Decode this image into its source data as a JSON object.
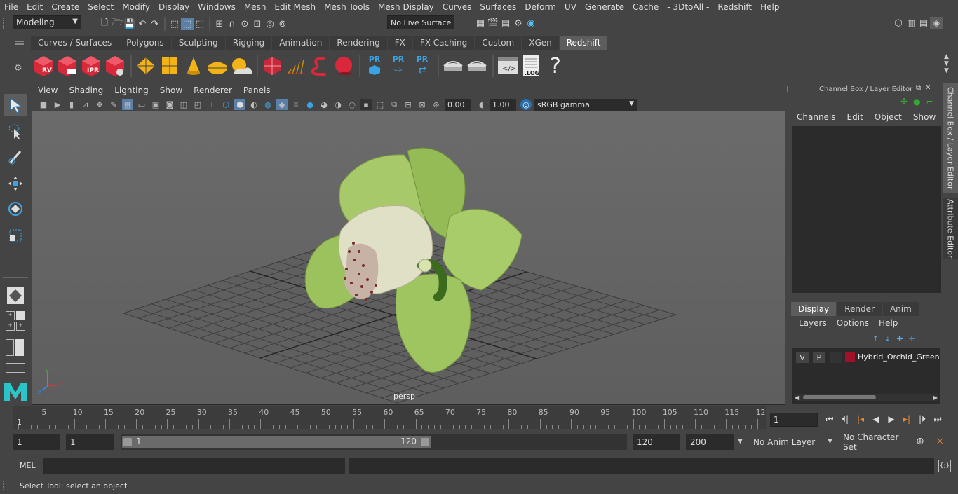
{
  "menu": [
    "File",
    "Edit",
    "Create",
    "Select",
    "Modify",
    "Display",
    "Windows",
    "Mesh",
    "Edit Mesh",
    "Mesh Tools",
    "Mesh Display",
    "Curves",
    "Surfaces",
    "Deform",
    "UV",
    "Generate",
    "Cache",
    "- 3DtoAll -",
    "Redshift",
    "Help"
  ],
  "status": {
    "mode": "Modeling",
    "live_surface": "No Live Surface"
  },
  "shelf_tabs": [
    "Curves / Surfaces",
    "Polygons",
    "Sculpting",
    "Rigging",
    "Animation",
    "Rendering",
    "FX",
    "FX Caching",
    "Custom",
    "XGen",
    "Redshift"
  ],
  "shelf_active": "Redshift",
  "shelf_labels": {
    "rv": "RV",
    "ipr": "IPR",
    "pr": "PR",
    "log": ".LOG",
    "help": "?"
  },
  "viewport": {
    "menu": [
      "View",
      "Shading",
      "Lighting",
      "Show",
      "Renderer",
      "Panels"
    ],
    "exposure": "0.00",
    "gamma": "1.00",
    "color_space": "sRGB gamma",
    "camera": "persp"
  },
  "channel_box": {
    "title": "Channel Box / Layer Editor",
    "menu": [
      "Channels",
      "Edit",
      "Object",
      "Show"
    ]
  },
  "side_tabs": [
    "Channel Box / Layer Editor",
    "Attribute Editor"
  ],
  "layer_editor": {
    "tabs": [
      "Display",
      "Render",
      "Anim"
    ],
    "active_tab": "Display",
    "menu": [
      "Layers",
      "Options",
      "Help"
    ],
    "layer": {
      "v": "V",
      "p": "P",
      "name": "Hybrid_Orchid_Green",
      "color": "#a0122a"
    }
  },
  "timeline": {
    "labels": [
      "5",
      "10",
      "15",
      "20",
      "25",
      "30",
      "35",
      "40",
      "45",
      "50",
      "55",
      "60",
      "65",
      "70",
      "75",
      "80",
      "85",
      "90",
      "95",
      "100",
      "105",
      "110",
      "115",
      "12"
    ],
    "start_label": "1",
    "current_frame": "1"
  },
  "range": {
    "start": "1",
    "playback_start": "1",
    "slider_start": "1",
    "slider_end": "120",
    "playback_end": "120",
    "end": "200",
    "anim_layer": "No Anim Layer",
    "character_set": "No Character Set"
  },
  "command": {
    "label": "MEL"
  },
  "help_line": "Select Tool: select an object",
  "colors": {
    "accent": "#5d5d5d",
    "redshift_red": "#d8283a",
    "gold": "#f2b318",
    "pr_blue": "#3aa3e3"
  }
}
